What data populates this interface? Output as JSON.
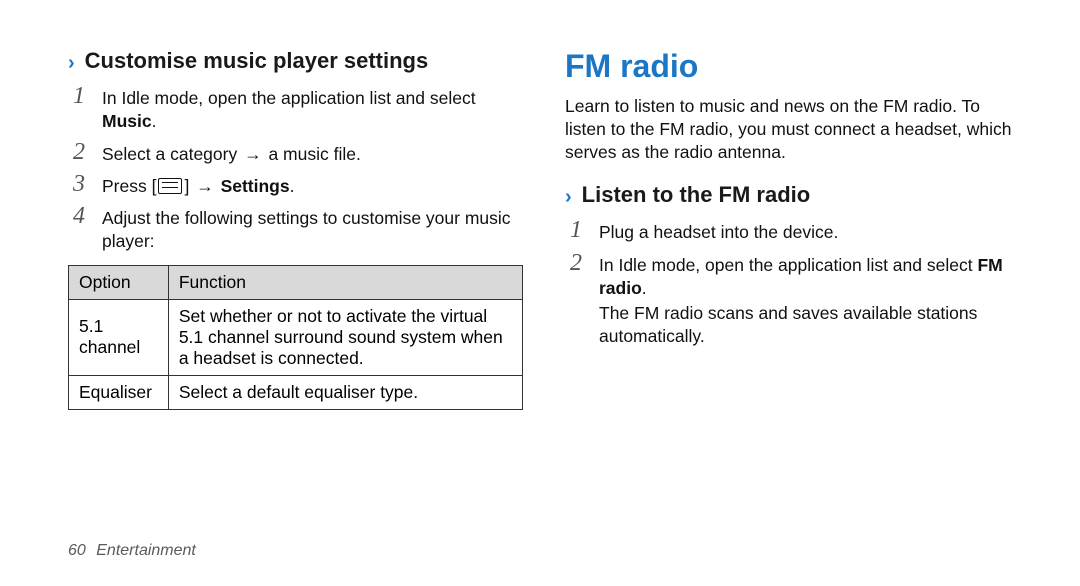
{
  "left": {
    "heading": "Customise music player settings",
    "steps": [
      {
        "num": "1",
        "pre": "In Idle mode, open the application list and select ",
        "bold": "Music",
        "post": "."
      },
      {
        "num": "2",
        "pre": "Select a category ",
        "arrow": "→",
        "post": " a music file."
      },
      {
        "num": "3",
        "pre": "Press [",
        "icon": true,
        "mid": "] ",
        "arrow": "→",
        "boldAfter": " Settings",
        "post": "."
      },
      {
        "num": "4",
        "pre": "Adjust the following settings to customise your music player:"
      }
    ],
    "table": {
      "headers": [
        "Option",
        "Function"
      ],
      "rows": [
        [
          "5.1 channel",
          "Set whether or not to activate the virtual 5.1 channel surround sound system when a headset is connected."
        ],
        [
          "Equaliser",
          "Select a default equaliser type."
        ]
      ]
    }
  },
  "right": {
    "section_heading": "FM radio",
    "intro": "Learn to listen to music and news on the FM radio. To listen to the FM radio, you must connect a headset, which serves as the radio antenna.",
    "sub_heading": "Listen to the FM radio",
    "steps": [
      {
        "num": "1",
        "pre": "Plug a headset into the device."
      },
      {
        "num": "2",
        "pre": "In Idle mode, open the application list and select ",
        "bold": "FM radio",
        "post": "."
      }
    ],
    "note": "The FM radio scans and saves available stations automatically."
  },
  "footer": {
    "page": "60",
    "section": "Entertainment"
  },
  "glyphs": {
    "chevron": "›"
  }
}
